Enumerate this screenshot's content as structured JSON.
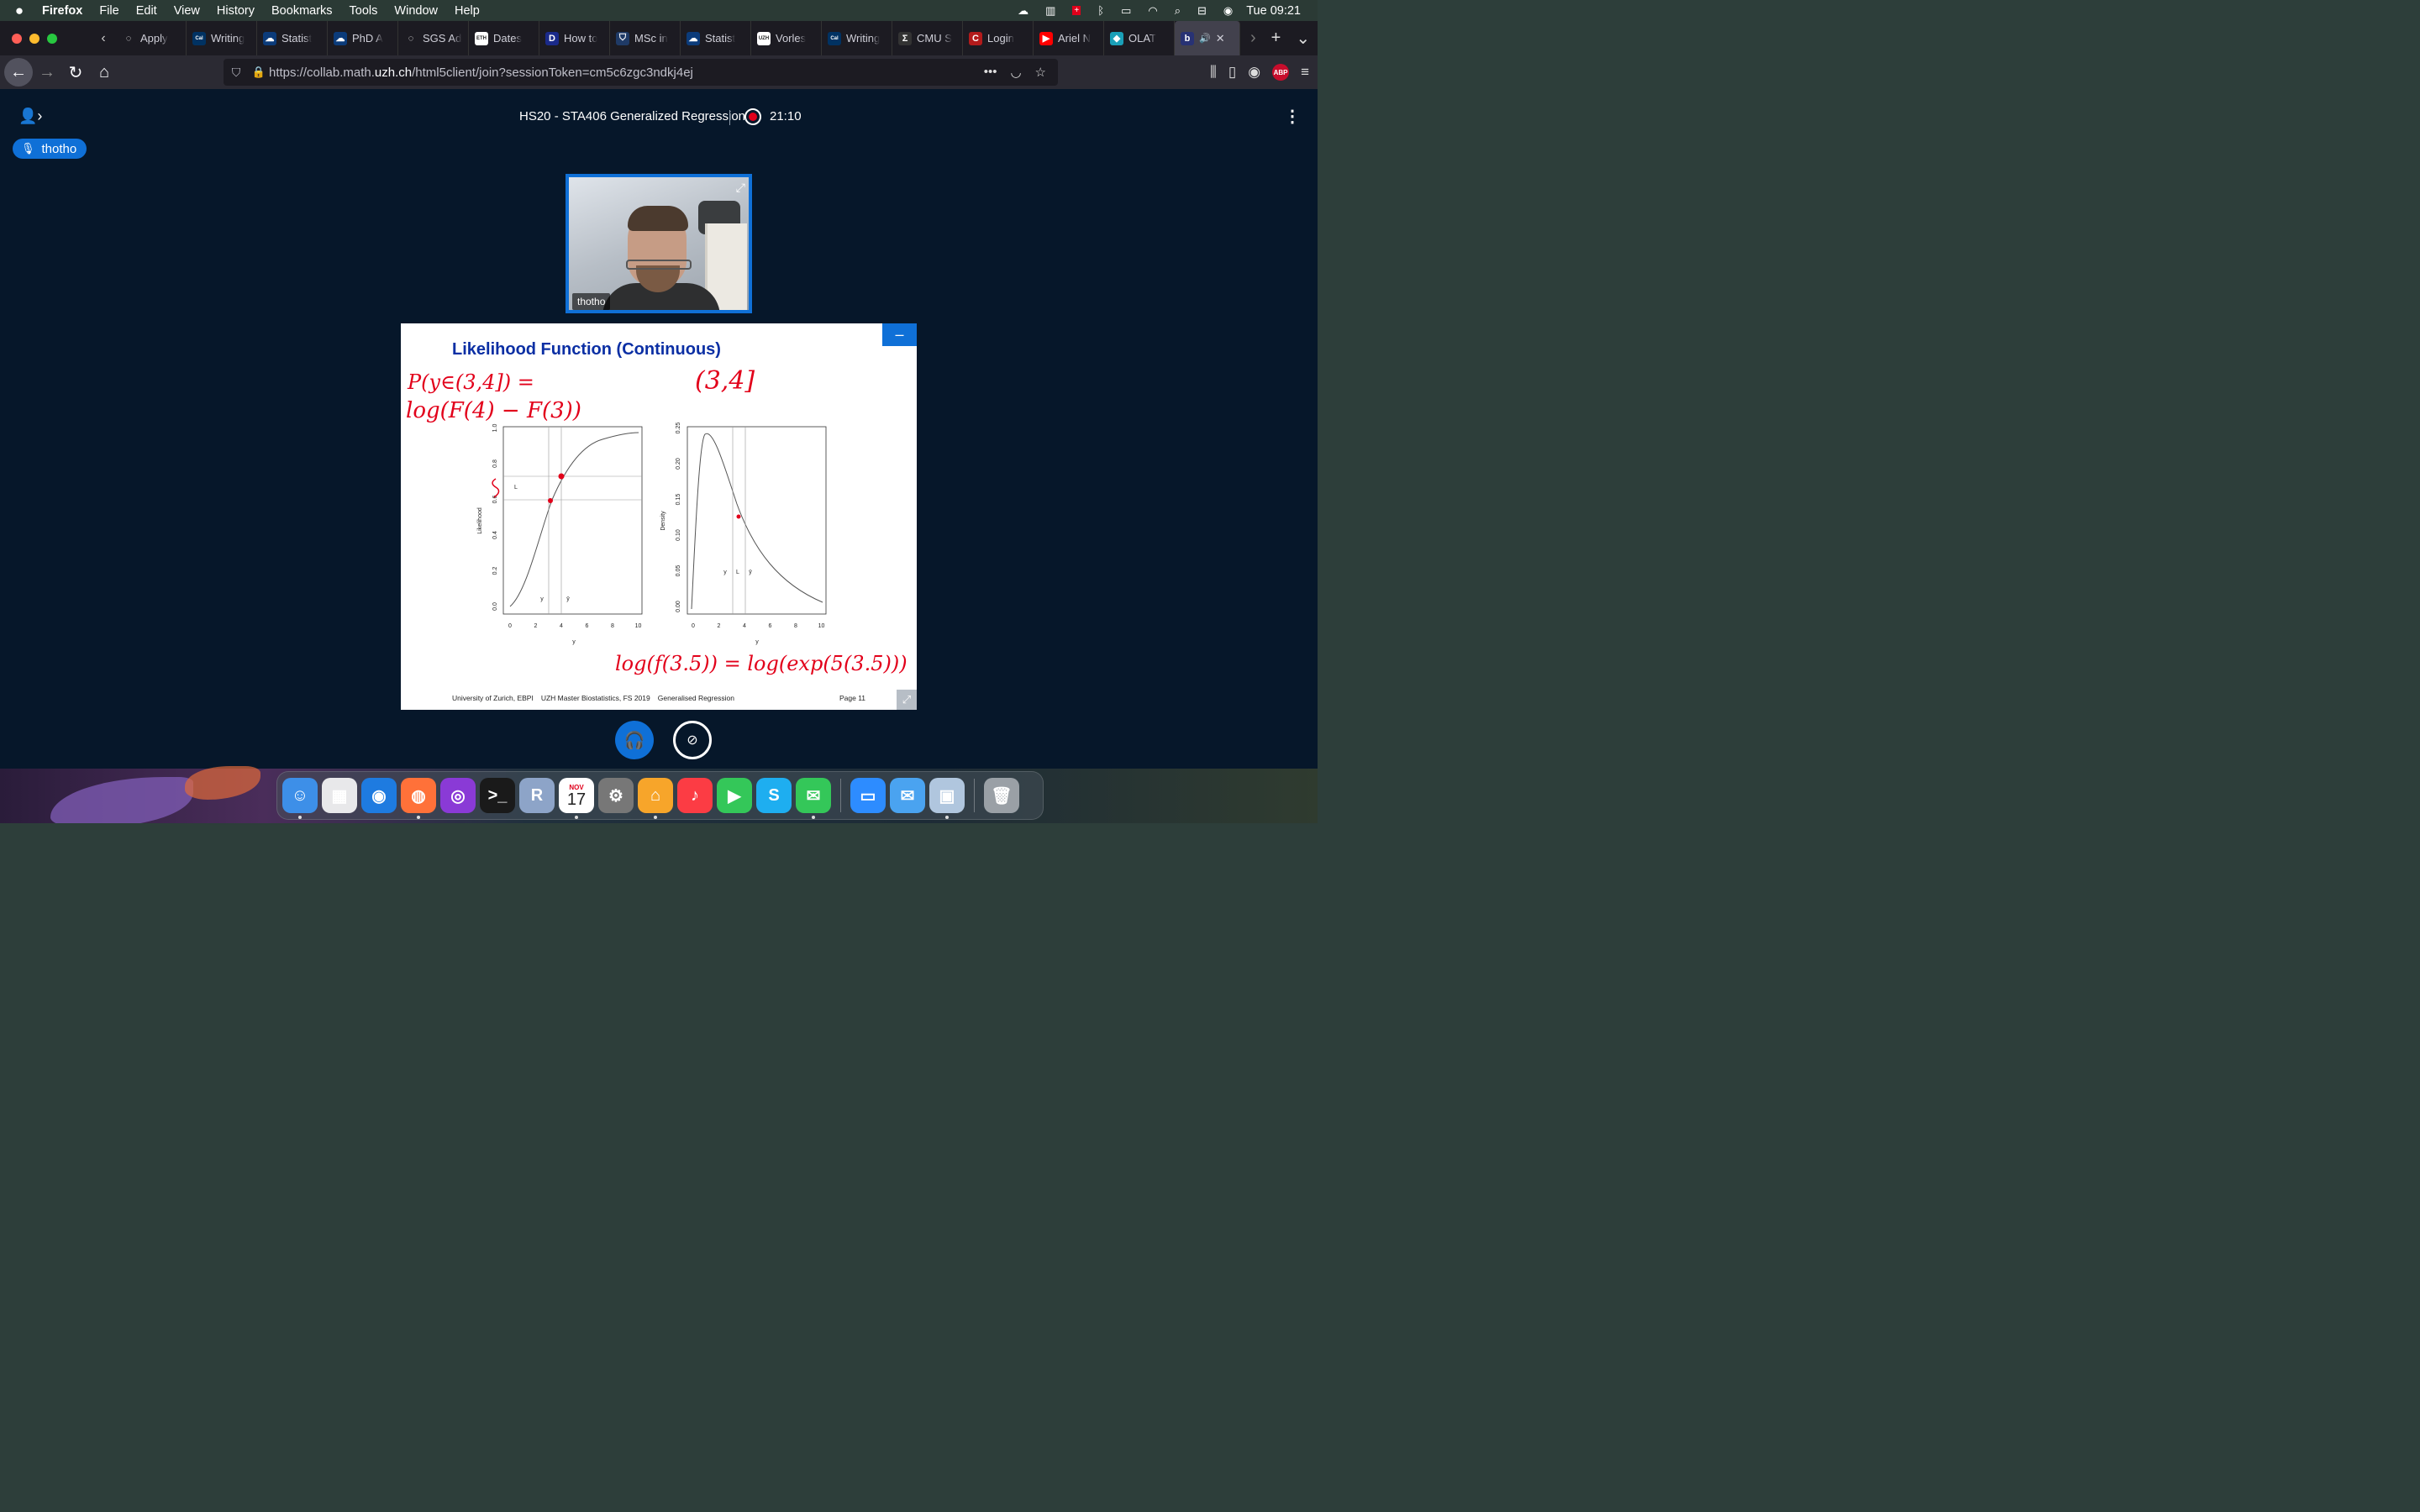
{
  "menubar": {
    "app": "Firefox",
    "items": [
      "File",
      "Edit",
      "View",
      "History",
      "Bookmarks",
      "Tools",
      "Window",
      "Help"
    ],
    "clock": "Tue 09:21"
  },
  "tabs": [
    {
      "label": "Apply",
      "icon": "generic-icon",
      "color": "#1c1b22"
    },
    {
      "label": "Writing",
      "icon": "cal-icon",
      "color": "#003262"
    },
    {
      "label": "Statist",
      "icon": "cloud-icon",
      "color": "#0b3b7a"
    },
    {
      "label": "PhD A",
      "icon": "cloud-icon",
      "color": "#0b3b7a"
    },
    {
      "label": "SGS Admis",
      "icon": "generic-icon",
      "color": "#1c1b22"
    },
    {
      "label": "Dates",
      "icon": "eth-icon",
      "color": "#ffffff"
    },
    {
      "label": "How to",
      "icon": "d-icon",
      "color": "#1a2a8a"
    },
    {
      "label": "MSc in",
      "icon": "shield-icon",
      "color": "#1f3a66"
    },
    {
      "label": "Statist",
      "icon": "cloud-icon",
      "color": "#0b3b7a"
    },
    {
      "label": "Vorles",
      "icon": "uzh-icon",
      "color": "#ffffff"
    },
    {
      "label": "Writing",
      "icon": "cal-icon",
      "color": "#003262"
    },
    {
      "label": "CMU S",
      "icon": "sigma-icon",
      "color": "#333333"
    },
    {
      "label": "Login",
      "icon": "c-icon",
      "color": "#b31b1b"
    },
    {
      "label": "Ariel N",
      "icon": "youtube-icon",
      "color": "#ff0000"
    },
    {
      "label": "OLAT",
      "icon": "olat-icon",
      "color": "#1aa0b8"
    },
    {
      "label": "",
      "icon": "bbb-icon",
      "color": "#283274",
      "active": true
    }
  ],
  "nav": {
    "url_prefix": "https://collab.math.",
    "url_domain": "uzh.ch",
    "url_path": "/html5client/join?sessionToken=cm5c6zgc3ndkj4ej"
  },
  "meeting": {
    "title": "HS20 - STA406 Generalized Regression",
    "recording_time": "21:10",
    "talker": "thotho",
    "webcam_name": "thotho"
  },
  "slide": {
    "title": "Likelihood Function (Continuous)",
    "footer": [
      "University of Zurich, EBPI",
      "UZH Master Biostatistics, FS 2019",
      "Generalised Regression"
    ],
    "page": "Page 11",
    "left_plot": {
      "ylabel": "Likelihood",
      "xlabel": "y",
      "yticks": [
        "0.0",
        "0.2",
        "0.4",
        "0.6",
        "0.8",
        "1.0"
      ],
      "xticks": [
        "0",
        "2",
        "4",
        "6",
        "8",
        "10"
      ],
      "labels": [
        "L",
        "y",
        "ȳ"
      ]
    },
    "right_plot": {
      "ylabel": "Density",
      "xlabel": "y",
      "yticks": [
        "0.00",
        "0.05",
        "0.10",
        "0.15",
        "0.20",
        "0.25"
      ],
      "xticks": [
        "0",
        "2",
        "4",
        "6",
        "8",
        "10"
      ],
      "labels": [
        "y",
        "L",
        "ȳ"
      ]
    },
    "annotations": [
      "P(y∈(3,4]) =",
      "log(F(4) − F(3))",
      "(3,4]",
      "log(f(3.5)) = log(exp(5(3.5)))"
    ]
  },
  "dock": [
    {
      "name": "finder-icon",
      "color": "#3d8fe8",
      "glyph": "☺"
    },
    {
      "name": "launchpad-icon",
      "color": "#e8e8ea",
      "glyph": "▦"
    },
    {
      "name": "safari-icon",
      "color": "#1e7be0",
      "glyph": "◉"
    },
    {
      "name": "firefox-icon",
      "color": "#ff7139",
      "glyph": "◍"
    },
    {
      "name": "podcasts-icon",
      "color": "#8a3ad6",
      "glyph": "◎"
    },
    {
      "name": "terminal-icon",
      "color": "#1a1a1a",
      "glyph": ">_"
    },
    {
      "name": "r-icon",
      "color": "#8da4c8",
      "glyph": "R"
    },
    {
      "name": "calendar-icon",
      "month": "NOV",
      "day": "17"
    },
    {
      "name": "system-preferences-icon",
      "color": "#777",
      "glyph": "⚙"
    },
    {
      "name": "home-icon",
      "color": "#f7a52a",
      "glyph": "⌂"
    },
    {
      "name": "music-icon",
      "color": "#fc3c44",
      "glyph": "♪"
    },
    {
      "name": "facetime-icon",
      "color": "#34c759",
      "glyph": "▶"
    },
    {
      "name": "skype-icon",
      "color": "#1eaef0",
      "glyph": "S"
    },
    {
      "name": "messages-icon",
      "color": "#34c759",
      "glyph": "✉"
    },
    {
      "name": "zoom-icon",
      "color": "#2d8cff",
      "glyph": "▭"
    },
    {
      "name": "mail-icon",
      "color": "#4aa3f0",
      "glyph": "✉"
    },
    {
      "name": "preview-icon",
      "color": "#b0c6de",
      "glyph": "▣"
    },
    {
      "name": "trash-icon",
      "color": "#9aa0a6",
      "glyph": "🗑"
    }
  ]
}
